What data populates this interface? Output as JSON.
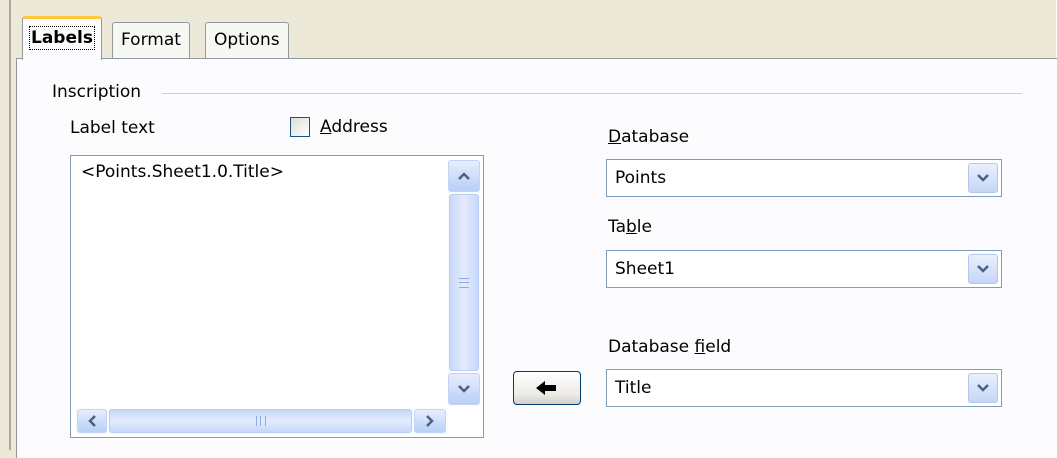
{
  "tabs": [
    {
      "label": "Labels",
      "active": true
    },
    {
      "label": "Format",
      "active": false
    },
    {
      "label": "Options",
      "active": false
    }
  ],
  "inscription": {
    "group_label": "Inscription",
    "label_text_label": "Label text",
    "address_checkbox": {
      "label": "Address",
      "mnemonic": "A",
      "rest": "ddress",
      "checked": false
    },
    "label_text_value": "<Points.Sheet1.0.Title>"
  },
  "database": {
    "label_mnemonic": "D",
    "label_rest": "atabase",
    "value": "Points"
  },
  "table": {
    "label_pre": "Ta",
    "label_mnemonic": "b",
    "label_rest": "le",
    "value": "Sheet1"
  },
  "database_field": {
    "label_pre": "Database ",
    "label_mnemonic": "f",
    "label_rest": "ield",
    "value": "Title"
  },
  "insert_button": {
    "icon": "arrow-left-icon"
  },
  "colors": {
    "accent_tab": "#ffc83c",
    "scroll_blue": "#b9d0f7",
    "border": "#7f9db9"
  }
}
